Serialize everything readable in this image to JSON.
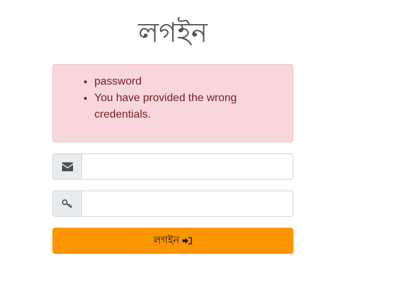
{
  "page": {
    "title": "লগইন"
  },
  "alert": {
    "errors": [
      "password",
      "You have provided the wrong credentials."
    ]
  },
  "form": {
    "email": {
      "icon": "envelope-icon",
      "value": "",
      "placeholder": ""
    },
    "password": {
      "icon": "key-icon",
      "value": "",
      "placeholder": ""
    },
    "submit": {
      "label": "লগইন",
      "icon": "sign-in-icon"
    }
  },
  "colors": {
    "alert_bg": "#f8d7da",
    "alert_text": "#721c24",
    "button_bg": "#ff9500",
    "addon_bg": "#e9ecef",
    "title": "#555555"
  }
}
